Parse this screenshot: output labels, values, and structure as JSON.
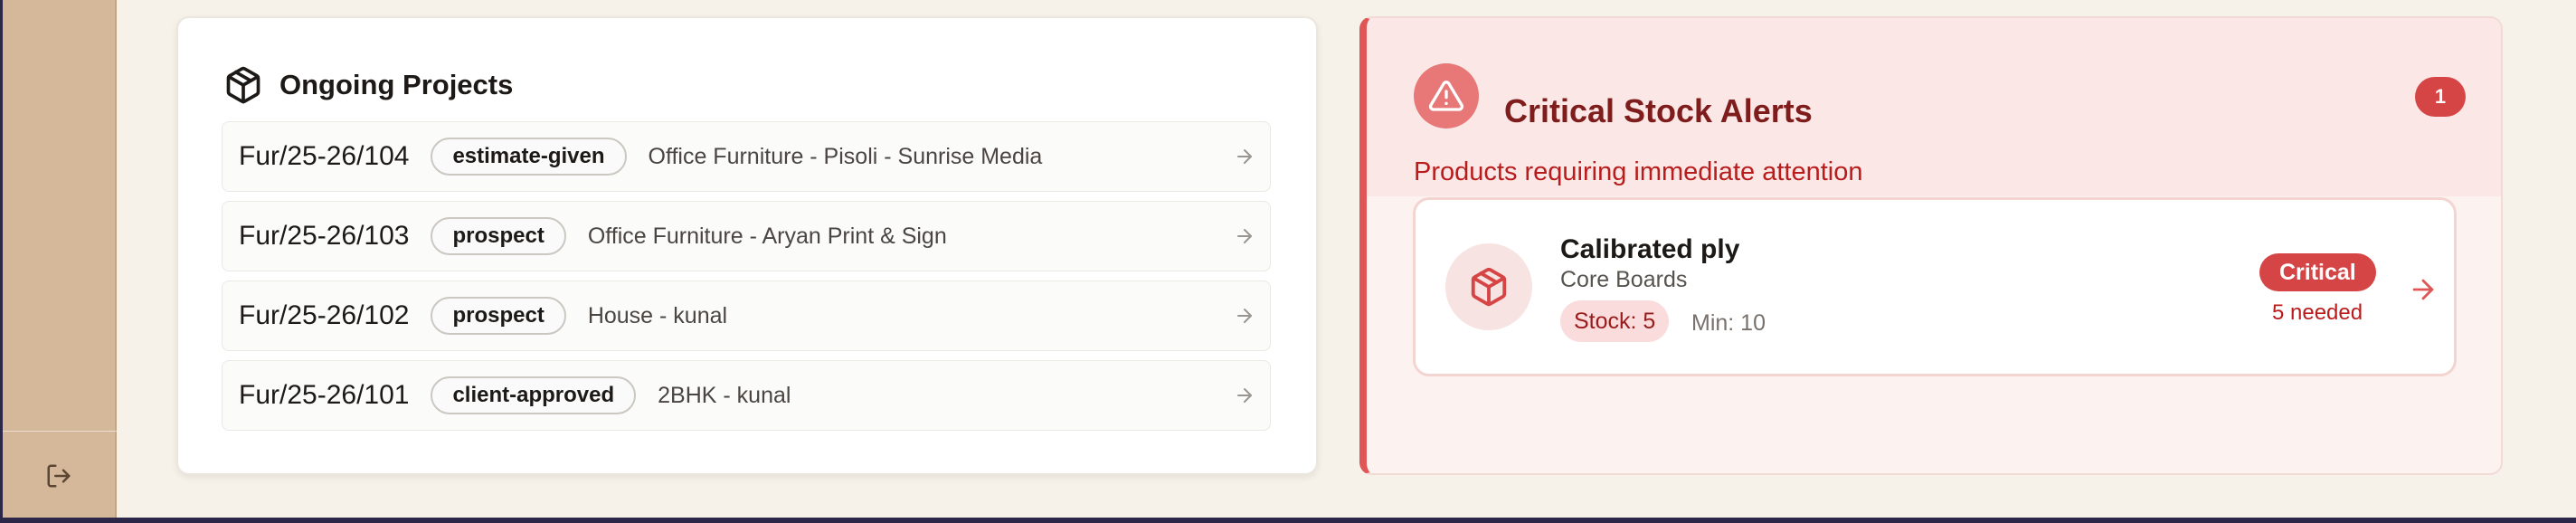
{
  "projects": {
    "title": "Ongoing Projects",
    "items": [
      {
        "code": "Fur/25-26/104",
        "status": "estimate-given",
        "description": "Office Furniture - Pisoli - Sunrise Media"
      },
      {
        "code": "Fur/25-26/103",
        "status": "prospect",
        "description": "Office Furniture - Aryan Print & Sign"
      },
      {
        "code": "Fur/25-26/102",
        "status": "prospect",
        "description": "House - kunal"
      },
      {
        "code": "Fur/25-26/101",
        "status": "client-approved",
        "description": "2BHK - kunal"
      }
    ]
  },
  "alerts": {
    "title": "Critical Stock Alerts",
    "subtitle": "Products requiring immediate attention",
    "count": "1",
    "items": [
      {
        "name": "Calibrated ply",
        "category": "Core Boards",
        "stock_label": "Stock: 5",
        "min_label": "Min: 10",
        "badge": "Critical",
        "needed": "5 needed"
      }
    ]
  },
  "icons": {
    "logout": "logout-icon",
    "projects": "package-icon",
    "alert": "warning-triangle-icon",
    "product": "package-icon",
    "arrow": "arrow-right-icon"
  },
  "colors": {
    "sidebar": "#d4b899",
    "background": "#f6f2ea",
    "critical": "#d64545",
    "alert_title": "#7f1d1d",
    "alert_accent": "#e05656"
  }
}
